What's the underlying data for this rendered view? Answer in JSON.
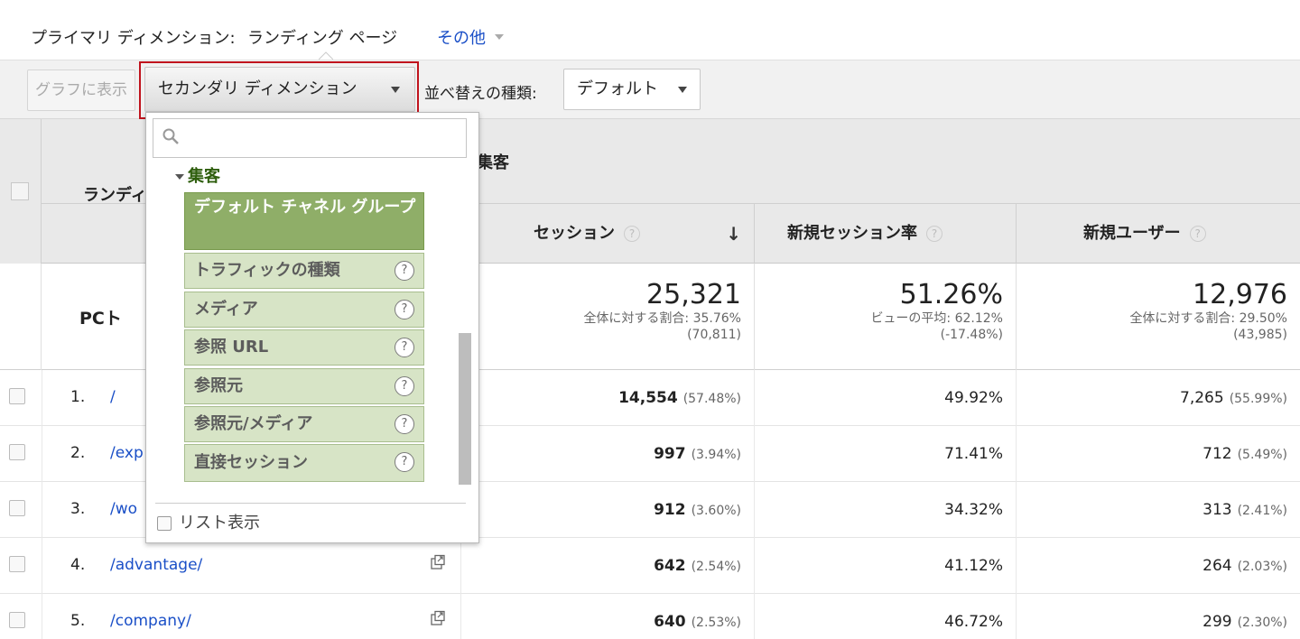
{
  "primary": {
    "label": "プライマリ ディメンション:",
    "value": "ランディング ページ",
    "other": "その他"
  },
  "toolbar": {
    "graph_button": "グラフに表示",
    "secondary_dimension": "セカンダリ ディメンション",
    "sort_label": "並べ替えの種類:",
    "sort_value": "デフォルト"
  },
  "table": {
    "landing_header": "ランディ",
    "acquisition_header": "集客",
    "columns": [
      "セッション",
      "新規セッション率",
      "新規ユーザー"
    ],
    "totals": {
      "label": "PCト",
      "sessions": {
        "value": "25,321",
        "note": "全体に対する割合: 35.76%",
        "base": "(70,811)"
      },
      "new_session_rate": {
        "value": "51.26%",
        "note": "ビューの平均: 62.12%",
        "base": "(-17.48%)"
      },
      "new_users": {
        "value": "12,976",
        "note": "全体に対する割合: 29.50%",
        "base": "(43,985)"
      }
    },
    "rows": [
      {
        "idx": "1.",
        "page": "/",
        "sessions": "14,554",
        "sessions_pct": "(57.48%)",
        "rate": "49.92%",
        "users": "7,265",
        "users_pct": "(55.99%)"
      },
      {
        "idx": "2.",
        "page": "/exp",
        "sessions": "997",
        "sessions_pct": "(3.94%)",
        "rate": "71.41%",
        "users": "712",
        "users_pct": "(5.49%)"
      },
      {
        "idx": "3.",
        "page": "/wo",
        "sessions": "912",
        "sessions_pct": "(3.60%)",
        "rate": "34.32%",
        "users": "313",
        "users_pct": "(2.41%)"
      },
      {
        "idx": "4.",
        "page": "/advantage/",
        "sessions": "642",
        "sessions_pct": "(2.54%)",
        "rate": "41.12%",
        "users": "264",
        "users_pct": "(2.03%)"
      },
      {
        "idx": "5.",
        "page": "/company/",
        "sessions": "640",
        "sessions_pct": "(2.53%)",
        "rate": "46.72%",
        "users": "299",
        "users_pct": "(2.30%)"
      }
    ]
  },
  "dropdown": {
    "search_placeholder": "",
    "group": "集客",
    "items": [
      "デフォルト チャネル グループ",
      "トラフィックの種類",
      "メディア",
      "参照 URL",
      "参照元",
      "参照元/メディア",
      "直接セッション"
    ],
    "list_view": "リスト表示",
    "help_glyph": "?"
  },
  "colors": {
    "link": "#1a4fc7",
    "selected_item": "#8fae68",
    "item_bg": "#d7e4c6",
    "highlight": "#c0131d"
  }
}
